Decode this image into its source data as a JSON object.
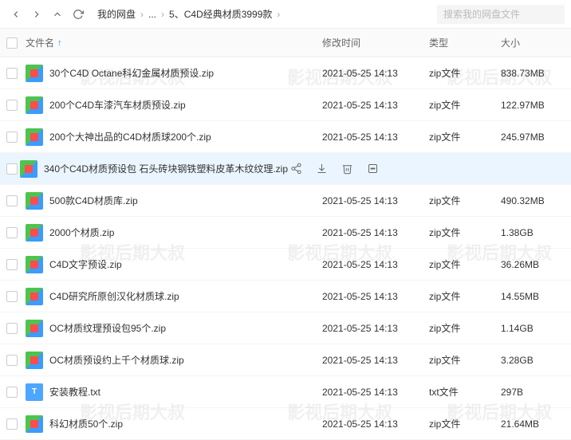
{
  "breadcrumb": {
    "root": "我的网盘",
    "ellipsis": "...",
    "current": "5、C4D经典材质3999款"
  },
  "search": {
    "placeholder": "搜索我的网盘文件"
  },
  "columns": {
    "name": "文件名",
    "date": "修改时间",
    "type": "类型",
    "size": "大小"
  },
  "hover_actions": [
    "share",
    "download",
    "delete",
    "more"
  ],
  "files": [
    {
      "name": "30个C4D Octane科幻金属材质预设.zip",
      "date": "2021-05-25 14:13",
      "type": "zip文件",
      "size": "838.73MB",
      "icon": "zip"
    },
    {
      "name": "200个C4D车漆汽车材质预设.zip",
      "date": "2021-05-25 14:13",
      "type": "zip文件",
      "size": "122.97MB",
      "icon": "zip"
    },
    {
      "name": "200个大神出品的C4D材质球200个.zip",
      "date": "2021-05-25 14:13",
      "type": "zip文件",
      "size": "245.97MB",
      "icon": "zip"
    },
    {
      "name": "340个C4D材质预设包 石头砖块钢铁塑料皮革木纹纹理.zip",
      "date": "2021-05-25 14:13",
      "type": "zip文件",
      "size": "",
      "icon": "zip",
      "hovered": true
    },
    {
      "name": "500款C4D材质库.zip",
      "date": "2021-05-25 14:13",
      "type": "zip文件",
      "size": "490.32MB",
      "icon": "zip"
    },
    {
      "name": "2000个材质.zip",
      "date": "2021-05-25 14:13",
      "type": "zip文件",
      "size": "1.38GB",
      "icon": "zip"
    },
    {
      "name": "C4D文字预设.zip",
      "date": "2021-05-25 14:13",
      "type": "zip文件",
      "size": "36.26MB",
      "icon": "zip"
    },
    {
      "name": "C4D研究所原创汉化材质球.zip",
      "date": "2021-05-25 14:13",
      "type": "zip文件",
      "size": "14.55MB",
      "icon": "zip"
    },
    {
      "name": "OC材质纹理预设包95个.zip",
      "date": "2021-05-25 14:13",
      "type": "zip文件",
      "size": "1.14GB",
      "icon": "zip"
    },
    {
      "name": "OC材质预设约上千个材质球.zip",
      "date": "2021-05-25 14:13",
      "type": "zip文件",
      "size": "3.28GB",
      "icon": "zip"
    },
    {
      "name": "安装教程.txt",
      "date": "2021-05-25 14:13",
      "type": "txt文件",
      "size": "297B",
      "icon": "txt"
    },
    {
      "name": "科幻材质50个.zip",
      "date": "2021-05-25 14:13",
      "type": "zip文件",
      "size": "21.64MB",
      "icon": "zip"
    }
  ],
  "watermark": "影视后期大叔"
}
